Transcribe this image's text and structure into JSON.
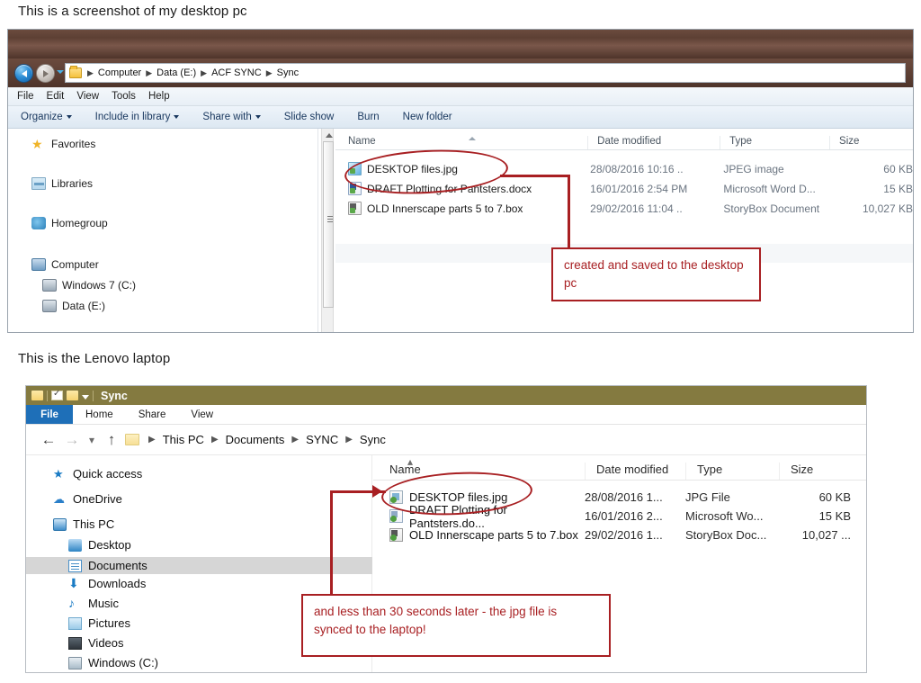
{
  "captions": {
    "desktop": "This is a screenshot of my desktop pc",
    "laptop": "This is the Lenovo laptop"
  },
  "accent": {
    "annotation_red": "#a81f22",
    "win10_title_olive": "#847a40",
    "win10_tab_blue": "#1e6fb8"
  },
  "window_desktop": {
    "address_crumbs": [
      "Computer",
      "Data (E:)",
      "ACF SYNC",
      "Sync"
    ],
    "menubar": [
      "File",
      "Edit",
      "View",
      "Tools",
      "Help"
    ],
    "toolbar": [
      {
        "label": "Organize",
        "caret": true
      },
      {
        "label": "Include in library",
        "caret": true
      },
      {
        "label": "Share with",
        "caret": true
      },
      {
        "label": "Slide show",
        "caret": false
      },
      {
        "label": "Burn",
        "caret": false
      },
      {
        "label": "New folder",
        "caret": false
      }
    ],
    "nav_items": [
      {
        "label": "Favorites",
        "icon": "star-icon"
      },
      {
        "label": "Libraries",
        "icon": "library-icon"
      },
      {
        "label": "Homegroup",
        "icon": "homegroup-icon"
      },
      {
        "label": "Computer",
        "icon": "computer-icon"
      },
      {
        "label": "Windows 7 (C:)",
        "icon": "drive-icon"
      },
      {
        "label": "Data (E:)",
        "icon": "drive-icon"
      }
    ],
    "columns": [
      "Name",
      "Date modified",
      "Type",
      "Size"
    ],
    "rows": [
      {
        "name": "DESKTOP files.jpg",
        "date": "28/08/2016 10:16 ..",
        "type": "JPEG image",
        "size": "60 KB",
        "icon": "jpeg-file-icon"
      },
      {
        "name": "DRAFT Plotting for Pantsters.docx",
        "date": "16/01/2016 2:54 PM",
        "type": "Microsoft Word D...",
        "size": "15 KB",
        "icon": "word-file-icon"
      },
      {
        "name": "OLD Innerscape parts 5 to 7.box",
        "date": "29/02/2016 11:04 ..",
        "type": "StoryBox Document",
        "size": "10,027 KB",
        "icon": "storybox-file-icon"
      }
    ],
    "annotation": "created and saved to the desktop pc"
  },
  "window_laptop": {
    "title": "Sync",
    "ribbon_tabs": [
      "File",
      "Home",
      "Share",
      "View"
    ],
    "address_crumbs": [
      "This PC",
      "Documents",
      "SYNC",
      "Sync"
    ],
    "nav_items": [
      {
        "label": "Quick access",
        "icon": "pin-star-icon",
        "level": 0,
        "selected": false
      },
      {
        "label": "OneDrive",
        "icon": "onedrive-cloud-icon",
        "level": 0,
        "selected": false
      },
      {
        "label": "This PC",
        "icon": "this-pc-icon",
        "level": 0,
        "selected": false
      },
      {
        "label": "Desktop",
        "icon": "desktop-icon",
        "level": 1,
        "selected": false
      },
      {
        "label": "Documents",
        "icon": "documents-icon",
        "level": 1,
        "selected": true
      },
      {
        "label": "Downloads",
        "icon": "downloads-icon",
        "level": 1,
        "selected": false
      },
      {
        "label": "Music",
        "icon": "music-icon",
        "level": 1,
        "selected": false
      },
      {
        "label": "Pictures",
        "icon": "pictures-icon",
        "level": 1,
        "selected": false
      },
      {
        "label": "Videos",
        "icon": "videos-icon",
        "level": 1,
        "selected": false
      },
      {
        "label": "Windows (C:)",
        "icon": "drive-icon",
        "level": 1,
        "selected": false
      }
    ],
    "columns": [
      "Name",
      "Date modified",
      "Type",
      "Size"
    ],
    "rows": [
      {
        "name": "DESKTOP files.jpg",
        "date": "28/08/2016 1...",
        "type": "JPG File",
        "size": "60 KB",
        "icon": "jpg-file-icon"
      },
      {
        "name": "DRAFT Plotting for Pantsters.do...",
        "date": "16/01/2016 2...",
        "type": "Microsoft Wo...",
        "size": "15 KB",
        "icon": "word-file-icon"
      },
      {
        "name": "OLD Innerscape parts 5 to 7.box",
        "date": "29/02/2016 1...",
        "type": "StoryBox Doc...",
        "size": "10,027 ...",
        "icon": "storybox-file-icon"
      }
    ],
    "annotation": "and less than 30 seconds later - the jpg file is synced to the laptop!"
  }
}
